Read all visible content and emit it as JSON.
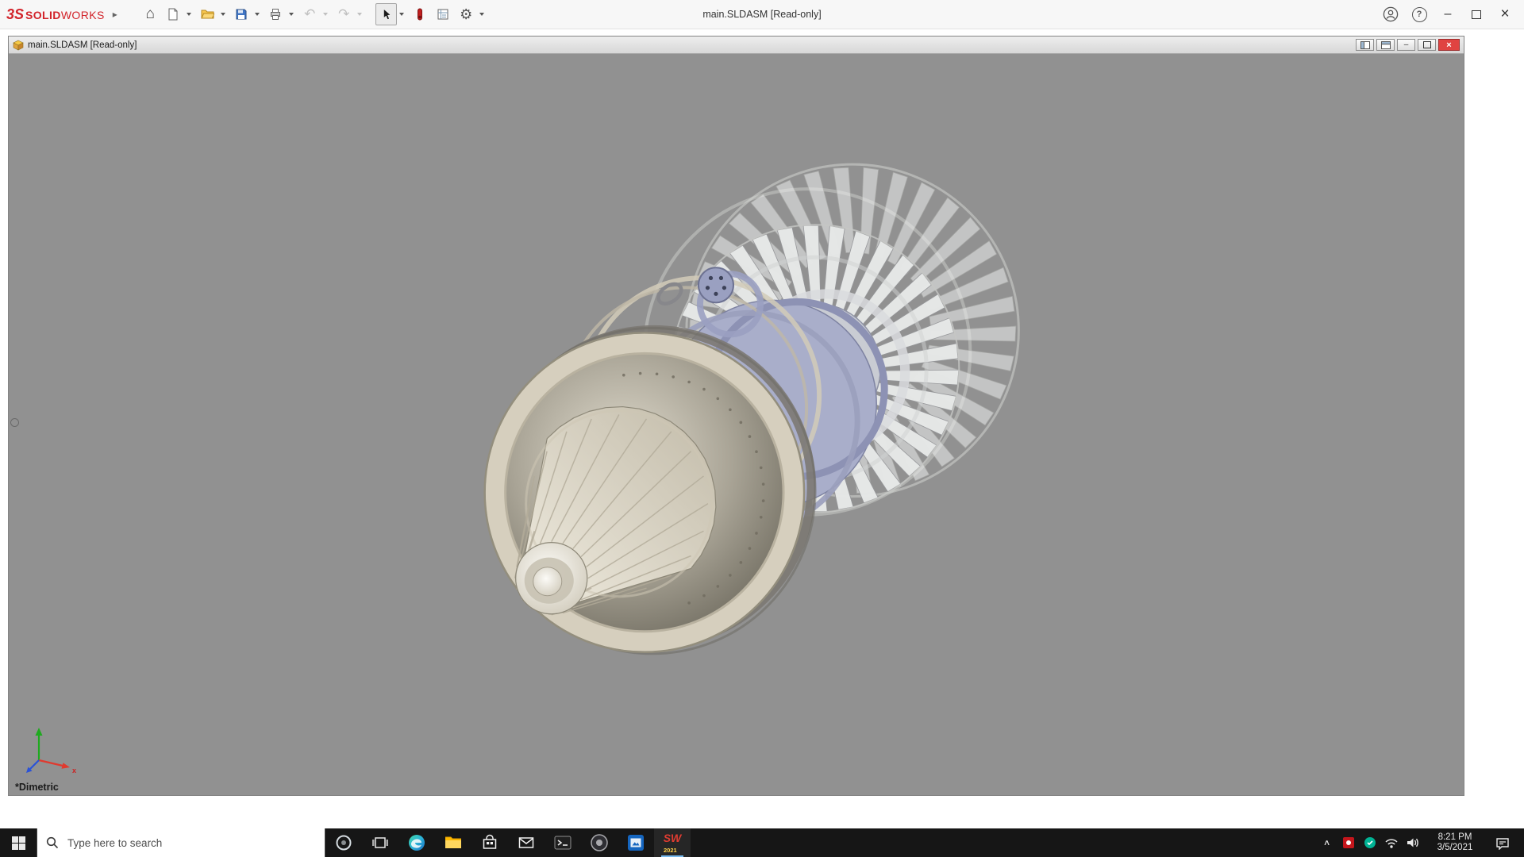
{
  "titlebar": {
    "brand_logo": "3S",
    "brand_bold": "SOLID",
    "brand_light": "WORKS",
    "window_title": "main.SLDASM [Read-only]",
    "glyphs": {
      "expand": "▸",
      "home": "⌂",
      "undo": "↶",
      "redo": "↷",
      "gear": "⚙",
      "help": "?",
      "minimize": "–",
      "close": "×"
    }
  },
  "child_window": {
    "title": "main.SLDASM [Read-only]",
    "glyphs": {
      "minimize": "–",
      "close": "×"
    }
  },
  "viewport": {
    "orientation_label": "*Dimetric",
    "background_color": "#919191",
    "model_name": "jet-engine-assembly",
    "model_colors": {
      "cream": "#d6cfbe",
      "cream_dark": "#938e7d",
      "cream_edge": "#b9b2a0",
      "blue_gray": "#a9aeca",
      "blue_gray_dark": "#7e83a2",
      "silver": "#e7e9e8",
      "silver_stroke": "#96979a",
      "ghost": "#edefee",
      "shadow": "#7c7973"
    }
  },
  "taskbar": {
    "search_placeholder": "Type here to search",
    "clock": {
      "time": "8:21 PM",
      "date": "3/5/2021"
    },
    "solidworks_mark": "SW",
    "solidworks_badge": "2021",
    "glyphs": {
      "tray_expand": "∧"
    }
  }
}
